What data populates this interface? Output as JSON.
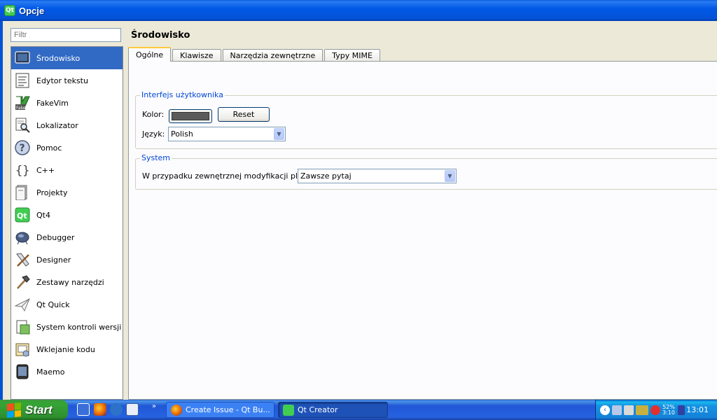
{
  "window": {
    "title": "Opcje",
    "app_icon_text": "Qt"
  },
  "filter": {
    "placeholder": "Filtr"
  },
  "sidebar": {
    "items": [
      {
        "label": "Środowisko",
        "icon": "monitor-icon",
        "selected": true
      },
      {
        "label": "Edytor tekstu",
        "icon": "text-editor-icon"
      },
      {
        "label": "FakeVim",
        "icon": "fakevim-icon"
      },
      {
        "label": "Lokalizator",
        "icon": "locator-icon"
      },
      {
        "label": "Pomoc",
        "icon": "help-icon"
      },
      {
        "label": "C++",
        "icon": "cpp-braces-icon"
      },
      {
        "label": "Projekty",
        "icon": "projects-icon"
      },
      {
        "label": "Qt4",
        "icon": "qt-icon"
      },
      {
        "label": "Debugger",
        "icon": "debugger-icon"
      },
      {
        "label": "Designer",
        "icon": "designer-icon"
      },
      {
        "label": "Zestawy narzędzi",
        "icon": "hammer-icon"
      },
      {
        "label": "Qt Quick",
        "icon": "paper-plane-icon"
      },
      {
        "label": "System kontroli wersji",
        "icon": "version-control-icon"
      },
      {
        "label": "Wklejanie kodu",
        "icon": "code-paste-icon"
      },
      {
        "label": "Maemo",
        "icon": "maemo-device-icon"
      }
    ]
  },
  "main": {
    "title": "Środowisko",
    "tabs": [
      {
        "label": "Ogólne",
        "active": true
      },
      {
        "label": "Klawisze"
      },
      {
        "label": "Narzędzia zewnętrzne"
      },
      {
        "label": "Typy MIME"
      }
    ],
    "ui_group": {
      "title": "Interfejs użytkownika",
      "color_label": "Kolor:",
      "color_value": "#5b5b5b",
      "reset_label": "Reset",
      "language_label": "Język:",
      "language_value": "Polish"
    },
    "system_group": {
      "title": "System",
      "ext_mod_label": "W przypadku zewnętrznej modyfikacji plików:",
      "ext_mod_value": "Zawsze pytaj"
    }
  },
  "taskbar": {
    "start_label": "Start",
    "tasks": [
      {
        "label": "Create Issue - Qt Bu..."
      },
      {
        "label": "Qt Creator"
      }
    ],
    "tray": {
      "battery_percent": "52%",
      "battery_time": "3:10",
      "clock": "13:01"
    }
  },
  "colors": {
    "accent": "#316ac5",
    "title_bar": "#0452d6",
    "group_title": "#0046d5"
  }
}
